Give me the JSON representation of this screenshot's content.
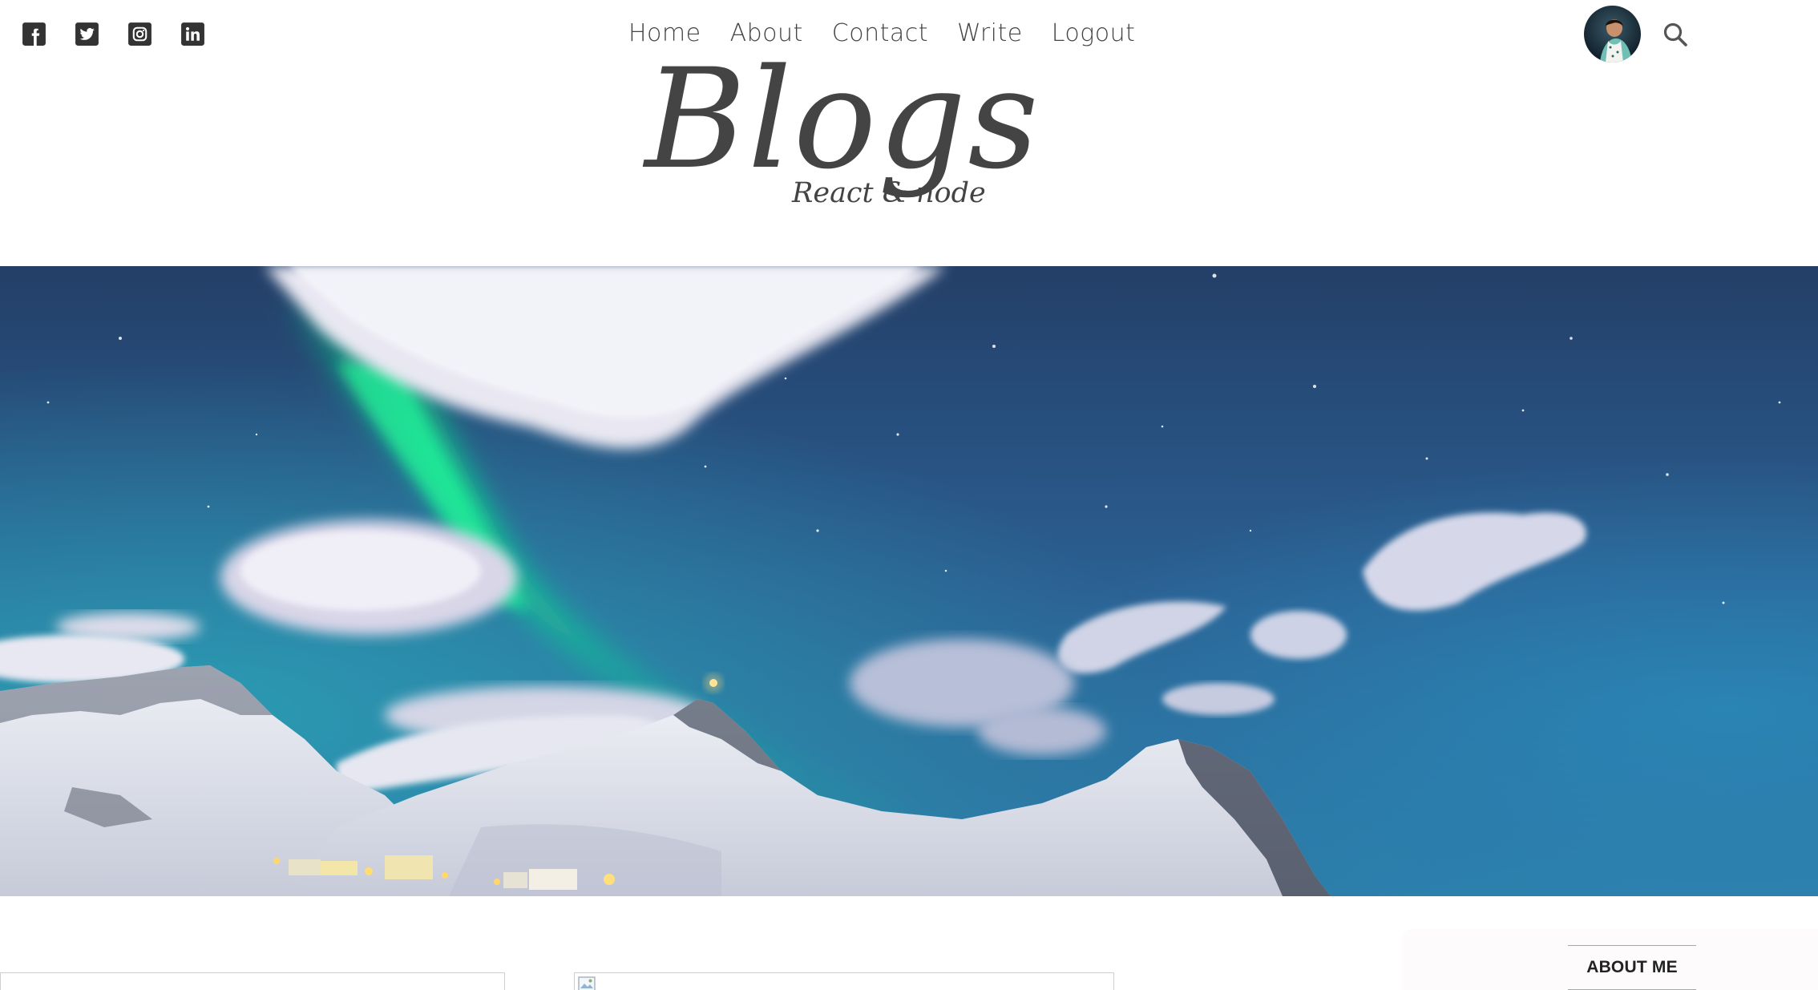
{
  "nav": {
    "items": [
      "Home",
      "About",
      "Contact",
      "Write",
      "Logout"
    ]
  },
  "social": {
    "icons": [
      "facebook-icon",
      "twitter-icon",
      "instagram-icon",
      "linkedin-icon"
    ]
  },
  "header": {
    "title_large": "Blogs",
    "title_small": "React & node"
  },
  "hero": {
    "description_icon": "northern-lights-mountain-photo"
  },
  "sidebar": {
    "title": "ABOUT ME"
  },
  "colors": {
    "text": "#444444",
    "sky_top": "#1d3a63",
    "sky_mid": "#2d6fa0",
    "aurora": "#12e38d",
    "sidebar_bg": "#fdfbfb"
  }
}
